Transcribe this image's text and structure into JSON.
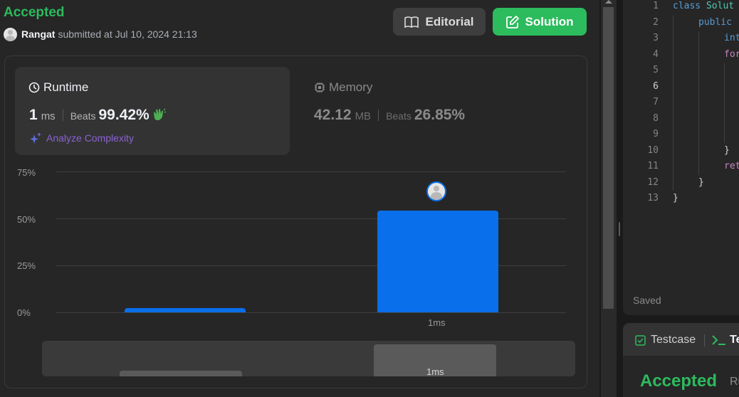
{
  "submission": {
    "status": "Accepted",
    "user": "Rangat",
    "submitted_text": "submitted at Jul 10, 2024 21:13"
  },
  "buttons": {
    "editorial": "Editorial",
    "solution": "Solution"
  },
  "runtime": {
    "title": "Runtime",
    "value": "1",
    "unit": "ms",
    "beats_label": "Beats",
    "beats_pct": "99.42%",
    "analyze": "Analyze Complexity"
  },
  "memory": {
    "title": "Memory",
    "value": "42.12",
    "unit": "MB",
    "beats_label": "Beats",
    "beats_pct": "26.85%"
  },
  "chart_data": {
    "type": "bar",
    "categories": [
      "",
      "1ms"
    ],
    "values": [
      1,
      54
    ],
    "yticks": [
      "75%",
      "50%",
      "25%",
      "0%"
    ],
    "ylim": [
      0,
      75
    ],
    "grid": true,
    "bar_color": "#0a6fea",
    "selected_category": "1ms"
  },
  "overview": {
    "label": "1ms"
  },
  "editor": {
    "line_numbers": [
      "1",
      "2",
      "3",
      "4",
      "5",
      "6",
      "7",
      "8",
      "9",
      "10",
      "11",
      "12",
      "13"
    ],
    "active_line": "6",
    "l1_kw": "class",
    "l1_name": "Solut",
    "l2_kw": "public",
    "l3_type": "int",
    "l4_ctl": "for",
    "l10": "}",
    "l11_ctl": "ret",
    "l12": "}",
    "l13": "}",
    "saved": "Saved"
  },
  "bottom_panel": {
    "tab_testcase": "Testcase",
    "tab_result": "Te",
    "result": "Accepted",
    "runtime_label": "Ru"
  },
  "colors": {
    "accepted": "#2cbb5d",
    "accent_blue": "#0a6fea",
    "analyze_purple": "#8a63d2"
  }
}
